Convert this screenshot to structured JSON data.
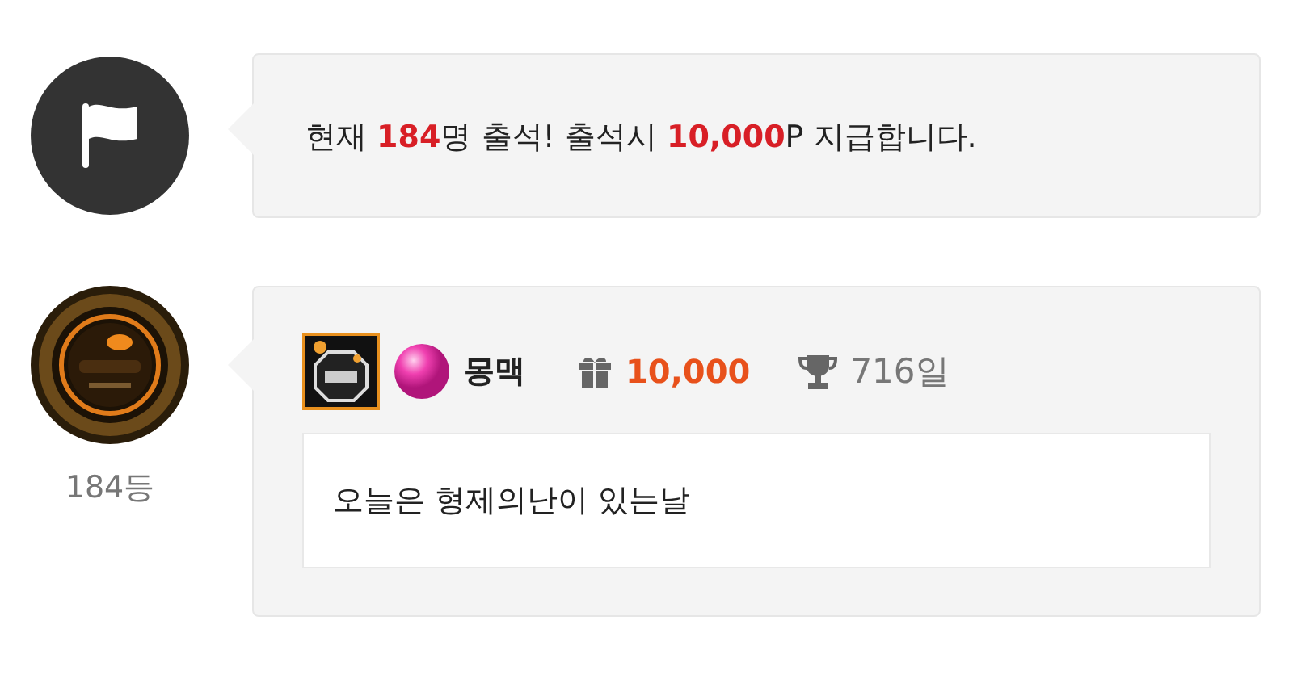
{
  "notice": {
    "text": "현재 **184**명 출석! 출석시 **10,000**P 지급합니다."
  },
  "entry": {
    "rank": "184등",
    "nickname": "몽맥",
    "points": "10,000",
    "days": "716일",
    "message": "오늘은 형제의난이 있는날"
  }
}
